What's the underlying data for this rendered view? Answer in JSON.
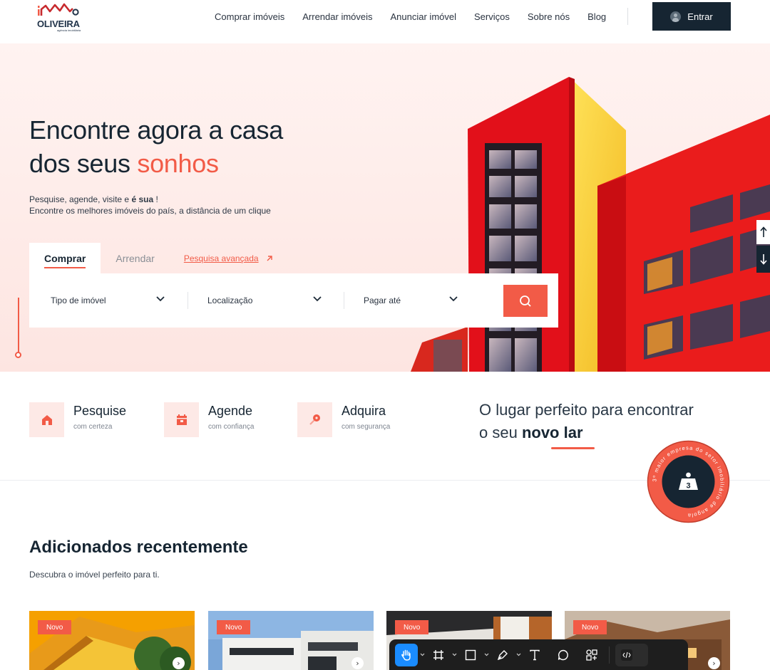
{
  "brand": {
    "name": "OLIVEIRA",
    "tagline": "agência imobiliária"
  },
  "nav": [
    "Comprar imóveis",
    "Arrendar imóveis",
    "Anunciar imóvel",
    "Serviços",
    "Sobre nós",
    "Blog"
  ],
  "login": {
    "label": "Entrar"
  },
  "hero": {
    "title_line1": "Encontre agora a casa",
    "title_line2_prefix": "dos seus ",
    "title_line2_accent": "sonhos",
    "sub_line1_prefix": "Pesquise,  agende, visite e ",
    "sub_line1_bold": "é sua",
    "sub_line1_suffix": " !",
    "sub_line2": "Encontre os melhores imóveis do país, a distância de um clique"
  },
  "search": {
    "tabs": [
      "Comprar",
      "Arrendar"
    ],
    "advanced": "Pesquisa avançada",
    "fields": [
      "Tipo de imóvel",
      "Localização",
      "Pagar até"
    ]
  },
  "features": [
    {
      "title": "Pesquise",
      "sub": "com certeza",
      "icon": "house-icon"
    },
    {
      "title": "Agende",
      "sub": "com confiança",
      "icon": "calendar-icon"
    },
    {
      "title": "Adquira",
      "sub": "com segurança",
      "icon": "key-icon"
    }
  ],
  "tagline": {
    "line1": "O lugar perfeito para encontrar",
    "line2_prefix": "o seu ",
    "line2_bold": "novo lar"
  },
  "badge": {
    "number": "3",
    "text": "3º maior empresa do setor imobiliário de angola"
  },
  "recent": {
    "title": "Adicionados recentemente",
    "sub": "Descubra o imóvel perfeito para ti.",
    "cards": [
      {
        "tag": "Novo"
      },
      {
        "tag": "Novo"
      },
      {
        "tag": "Novo"
      },
      {
        "tag": "Novo"
      }
    ]
  },
  "colors": {
    "accent": "#f25b47",
    "dark": "#162532"
  }
}
